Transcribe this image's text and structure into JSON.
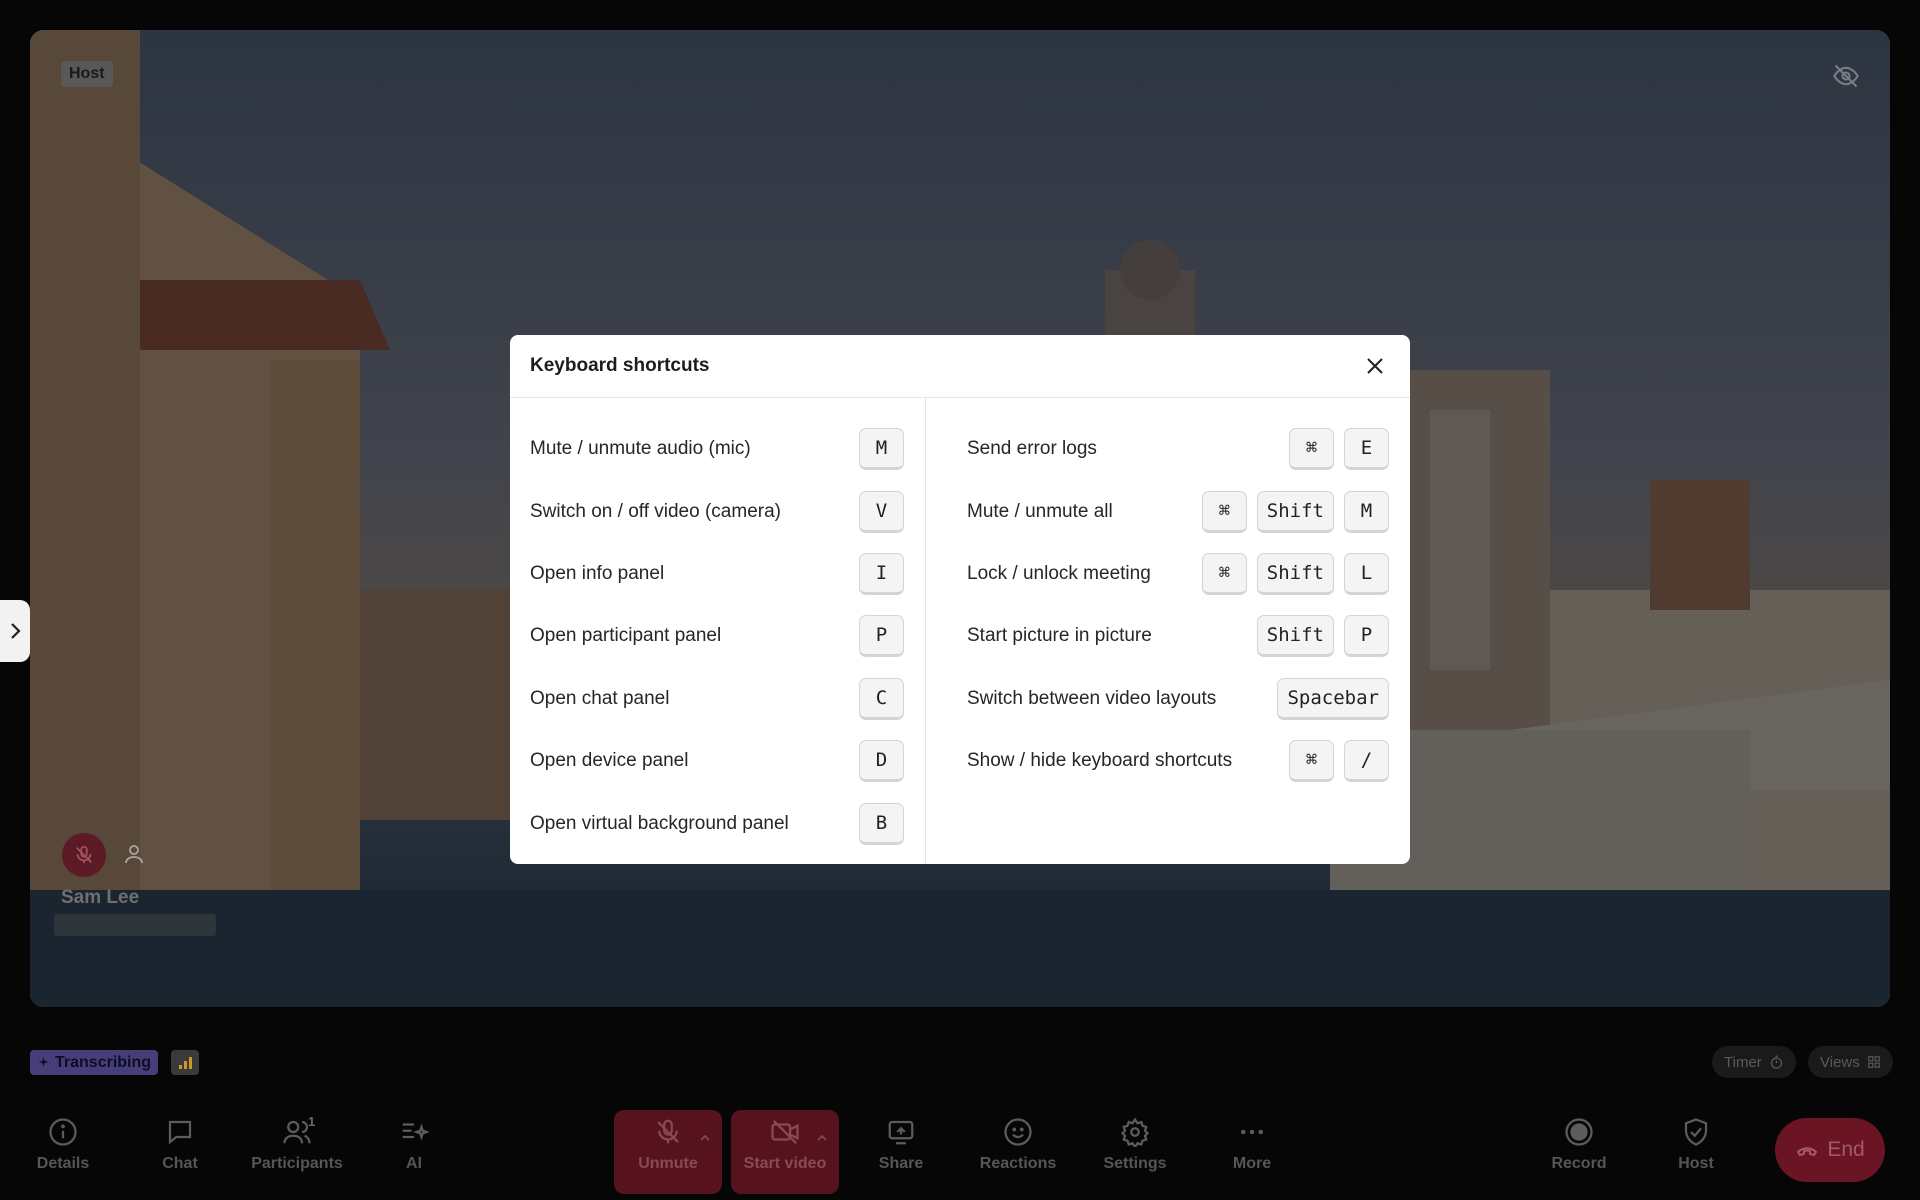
{
  "stage": {
    "host_tag": "Host",
    "participant": {
      "name": "Sam Lee"
    }
  },
  "modal": {
    "title": "Keyboard shortcuts",
    "left": [
      {
        "label": "Mute / unmute audio (mic)",
        "keys": [
          "M"
        ]
      },
      {
        "label": "Switch on / off video (camera)",
        "keys": [
          "V"
        ]
      },
      {
        "label": "Open info panel",
        "keys": [
          "I"
        ]
      },
      {
        "label": "Open participant panel",
        "keys": [
          "P"
        ]
      },
      {
        "label": "Open chat panel",
        "keys": [
          "C"
        ]
      },
      {
        "label": "Open device panel",
        "keys": [
          "D"
        ]
      },
      {
        "label": "Open virtual background panel",
        "keys": [
          "B"
        ]
      }
    ],
    "right": [
      {
        "label": "Send error logs",
        "keys": [
          "⌘",
          "E"
        ]
      },
      {
        "label": "Mute / unmute all",
        "keys": [
          "⌘",
          "Shift",
          "M"
        ]
      },
      {
        "label": "Lock / unlock meeting",
        "keys": [
          "⌘",
          "Shift",
          "L"
        ]
      },
      {
        "label": "Start picture in picture",
        "keys": [
          "Shift",
          "P"
        ]
      },
      {
        "label": "Switch between video layouts",
        "keys": [
          "Spacebar"
        ]
      },
      {
        "label": "Show / hide keyboard shortcuts",
        "keys": [
          "⌘",
          "/"
        ]
      }
    ]
  },
  "status": {
    "transcribing": "Transcribing",
    "timer": "Timer",
    "views": "Views"
  },
  "toolbar": {
    "details": "Details",
    "chat": "Chat",
    "participants": "Participants",
    "participants_count": "1",
    "ai": "AI",
    "unmute": "Unmute",
    "start_video": "Start video",
    "share": "Share",
    "reactions": "Reactions",
    "settings": "Settings",
    "more": "More",
    "record": "Record",
    "host": "Host",
    "end": "End"
  },
  "colors": {
    "accent_red": "#57131d",
    "transcribing": "#7c6dd6",
    "modal_bg": "#ffffff"
  }
}
